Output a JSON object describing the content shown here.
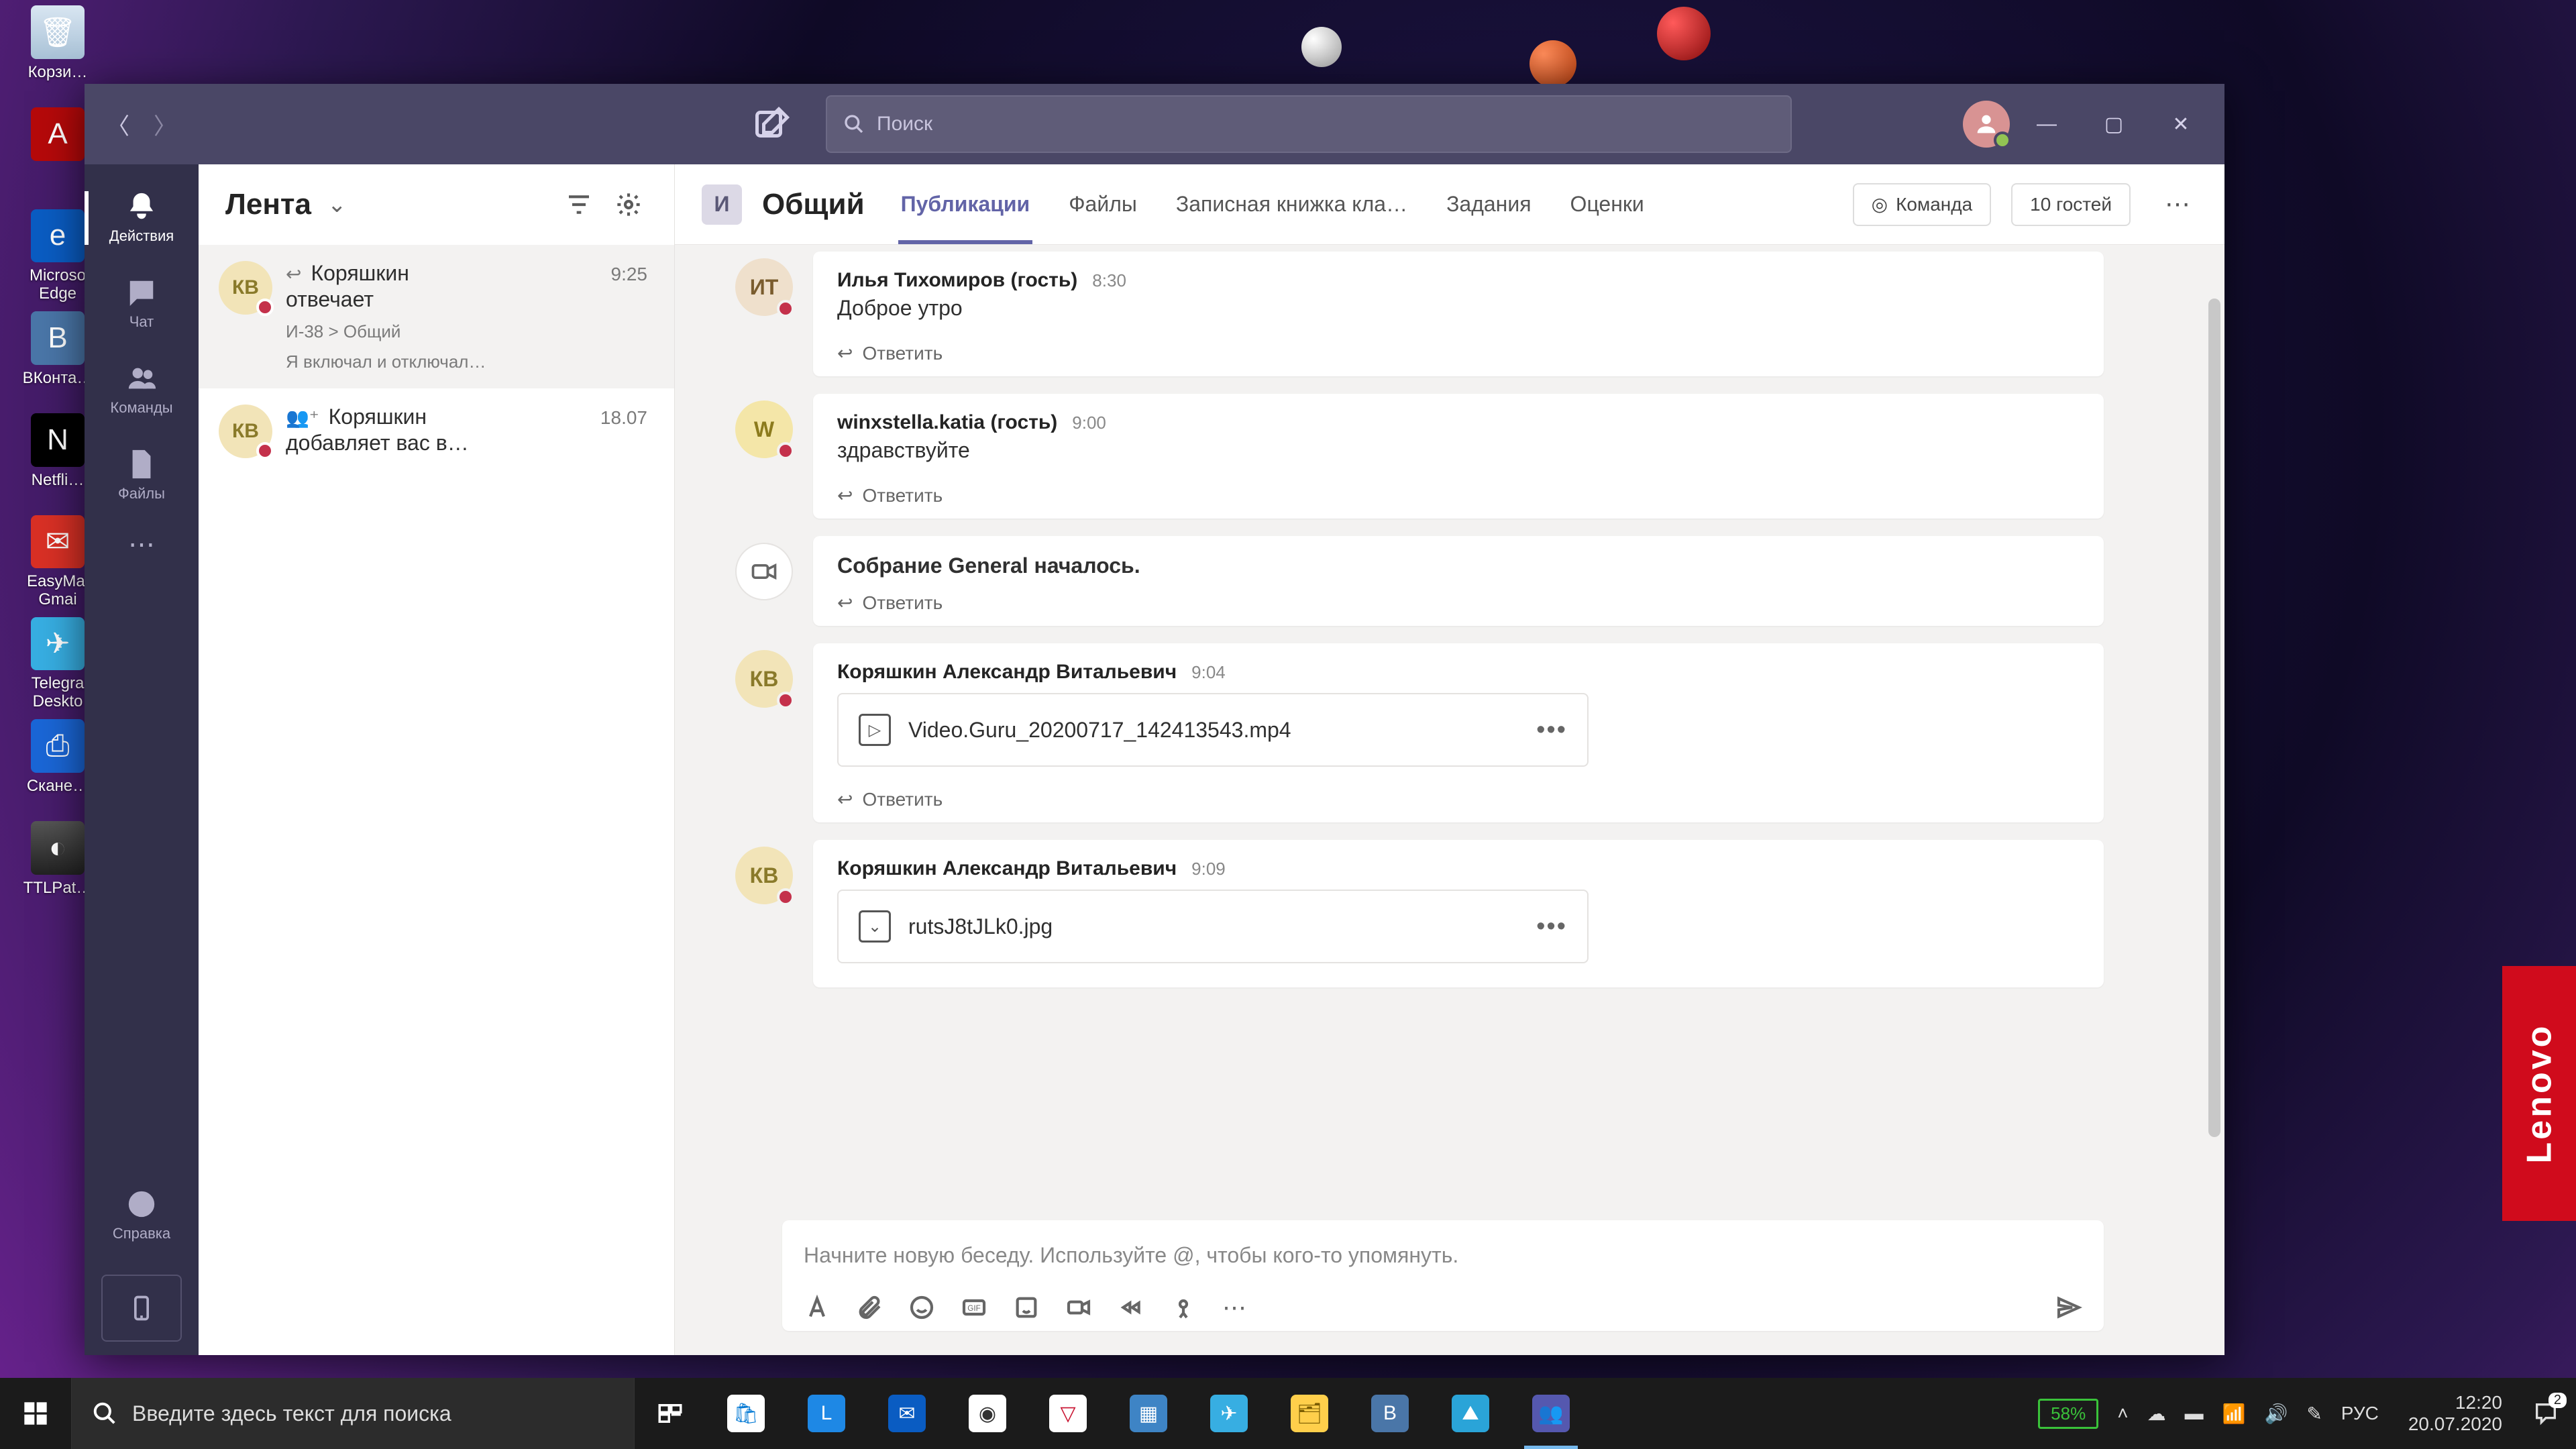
{
  "desktop": {
    "icons": [
      {
        "label": "Корзи…",
        "glyph": "🗑",
        "cls": "bg-recycle"
      },
      {
        "label": "",
        "glyph": "A",
        "cls": "bg-adobe"
      },
      {
        "label": "Microso Edge",
        "glyph": "e",
        "cls": "bg-edge"
      },
      {
        "label": "ВКонта…",
        "glyph": "В",
        "cls": "bg-vk"
      },
      {
        "label": "Netfli…",
        "glyph": "N",
        "cls": "bg-netflix"
      },
      {
        "label": "EasyMai Gmai",
        "glyph": "✉",
        "cls": "bg-gmail"
      },
      {
        "label": "Telegra Deskto",
        "glyph": "✈",
        "cls": "bg-telegram"
      },
      {
        "label": "Скане…",
        "glyph": "⎙",
        "cls": "bg-scanner"
      },
      {
        "label": "TTLPat…",
        "glyph": "◐",
        "cls": "bg-ttl"
      }
    ]
  },
  "teams": {
    "search_placeholder": "Поиск",
    "rail": [
      {
        "label": "Действия",
        "key": "activity"
      },
      {
        "label": "Чат",
        "key": "chat"
      },
      {
        "label": "Команды",
        "key": "teams"
      },
      {
        "label": "Файлы",
        "key": "files"
      }
    ],
    "rail_help": "Справка",
    "feed": {
      "title": "Лента",
      "items": [
        {
          "initials": "КВ",
          "avatar_bg": "#f2e4b8",
          "avatar_fg": "#8a7a2a",
          "pre_icon": "↩",
          "title_line1": "Коряшкин",
          "title_line2": "отвечает",
          "time": "9:25",
          "sub1": "И-38 > Общий",
          "sub2": "Я включал и отключал…"
        },
        {
          "initials": "КВ",
          "avatar_bg": "#f2e4b8",
          "avatar_fg": "#8a7a2a",
          "pre_icon": "👥⁺",
          "title_line1": "Коряшкин",
          "title_line2": "добавляет вас в…",
          "time": "18.07",
          "sub1": "",
          "sub2": ""
        }
      ]
    },
    "channel": {
      "team_initial": "И",
      "name": "Общий",
      "tabs": [
        "Публикации",
        "Файлы",
        "Записная книжка кла…",
        "Задания",
        "Оценки"
      ],
      "active_tab": 0,
      "team_btn": "Команда",
      "guests_btn": "10 гостей",
      "posts": [
        {
          "kind": "msg",
          "initials": "ИТ",
          "avatar_bg": "#efe0cc",
          "avatar_fg": "#7a5c2e",
          "author": "Илья Тихомиров (гость)",
          "time": "8:30",
          "text": "Доброе утро",
          "reply": "Ответить"
        },
        {
          "kind": "msg",
          "initials": "W",
          "avatar_bg": "#f4e6a8",
          "avatar_fg": "#8c7b1d",
          "author": "winxstella.katia (гость)",
          "time": "9:00",
          "text": "здравствуйте",
          "reply": "Ответить"
        },
        {
          "kind": "meeting",
          "text": "Собрание General началось.",
          "reply": "Ответить"
        },
        {
          "kind": "file",
          "initials": "КВ",
          "avatar_bg": "#f2e4b8",
          "avatar_fg": "#8a7a2a",
          "author": "Коряшкин Александр Витальевич",
          "time": "9:04",
          "file_icon": "▷",
          "file_name": "Video.Guru_20200717_142413543.mp4",
          "reply": "Ответить"
        },
        {
          "kind": "file",
          "initials": "КВ",
          "avatar_bg": "#f2e4b8",
          "avatar_fg": "#8a7a2a",
          "author": "Коряшкин Александр Витальевич",
          "time": "9:09",
          "file_icon": "⌄",
          "file_name": "rutsJ8tJLk0.jpg",
          "reply": ""
        }
      ],
      "compose_placeholder": "Начните новую беседу. Используйте @, чтобы кого-то упомянуть."
    }
  },
  "taskbar": {
    "search_placeholder": "Введите здесь текст для поиска",
    "battery": "58%",
    "lang": "РУС",
    "time": "12:20",
    "date": "20.07.2020",
    "notif_count": "2"
  },
  "lenovo": "Lenovo"
}
